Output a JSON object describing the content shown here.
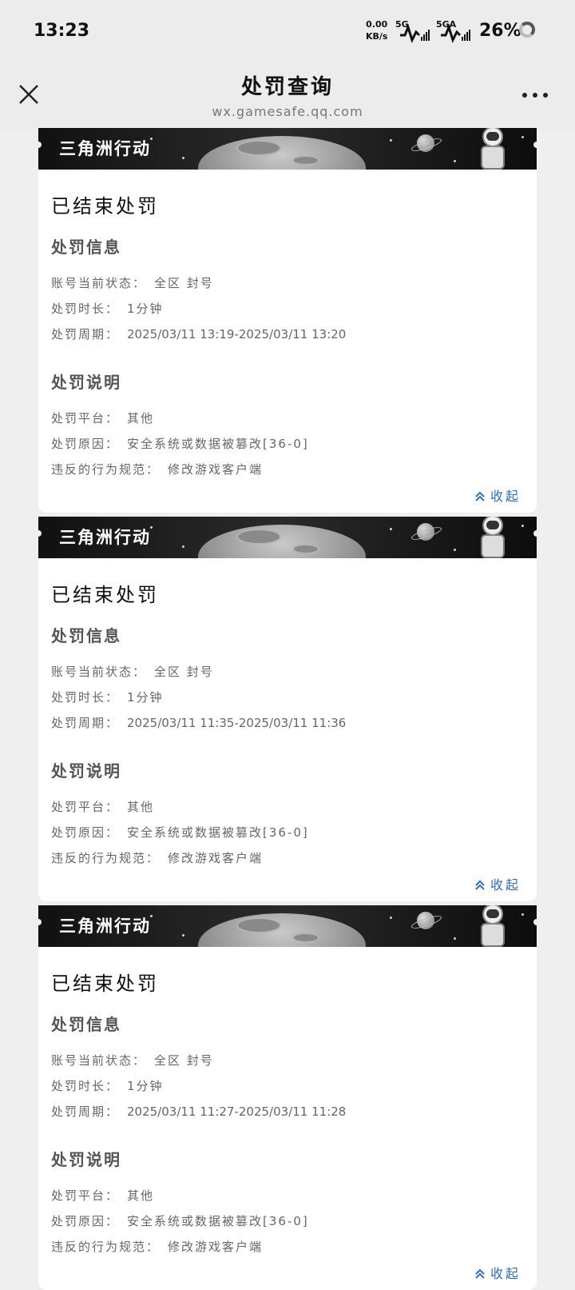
{
  "status_bar": {
    "time": "13:23",
    "net_speed_value": "0.00",
    "net_speed_unit": "KB/s",
    "signal1_label": "5G",
    "signal2_label": "5GA",
    "battery": "26%"
  },
  "nav": {
    "title": "处罚查询",
    "subtitle": "wx.gamesafe.qq.com",
    "close_icon": "close-icon",
    "more_icon": "more-icon"
  },
  "labels": {
    "section_info": "处罚信息",
    "section_desc": "处罚说明",
    "account_status": "账号当前状态：",
    "duration": "处罚时长：",
    "period": "处罚周期：",
    "platform": "处罚平台：",
    "reason": "处罚原因：",
    "violation": "违反的行为规范：",
    "collapse": "收起"
  },
  "records": [
    {
      "game": "三角洲行动",
      "status": "已结束处罚",
      "account_status": "全区 封号",
      "duration": "1分钟",
      "period": "2025/03/11 13:19-2025/03/11 13:20",
      "platform": "其他",
      "reason": "安全系统或数据被篡改[36-0]",
      "violation": "修改游戏客户端"
    },
    {
      "game": "三角洲行动",
      "status": "已结束处罚",
      "account_status": "全区 封号",
      "duration": "1分钟",
      "period": "2025/03/11 11:35-2025/03/11 11:36",
      "platform": "其他",
      "reason": "安全系统或数据被篡改[36-0]",
      "violation": "修改游戏客户端"
    },
    {
      "game": "三角洲行动",
      "status": "已结束处罚",
      "account_status": "全区 封号",
      "duration": "1分钟",
      "period": "2025/03/11 11:27-2025/03/11 11:28",
      "platform": "其他",
      "reason": "安全系统或数据被篡改[36-0]",
      "violation": "修改游戏客户端"
    }
  ],
  "colors": {
    "link": "#2b6cd6",
    "background": "#efefef",
    "card": "#ffffff"
  }
}
